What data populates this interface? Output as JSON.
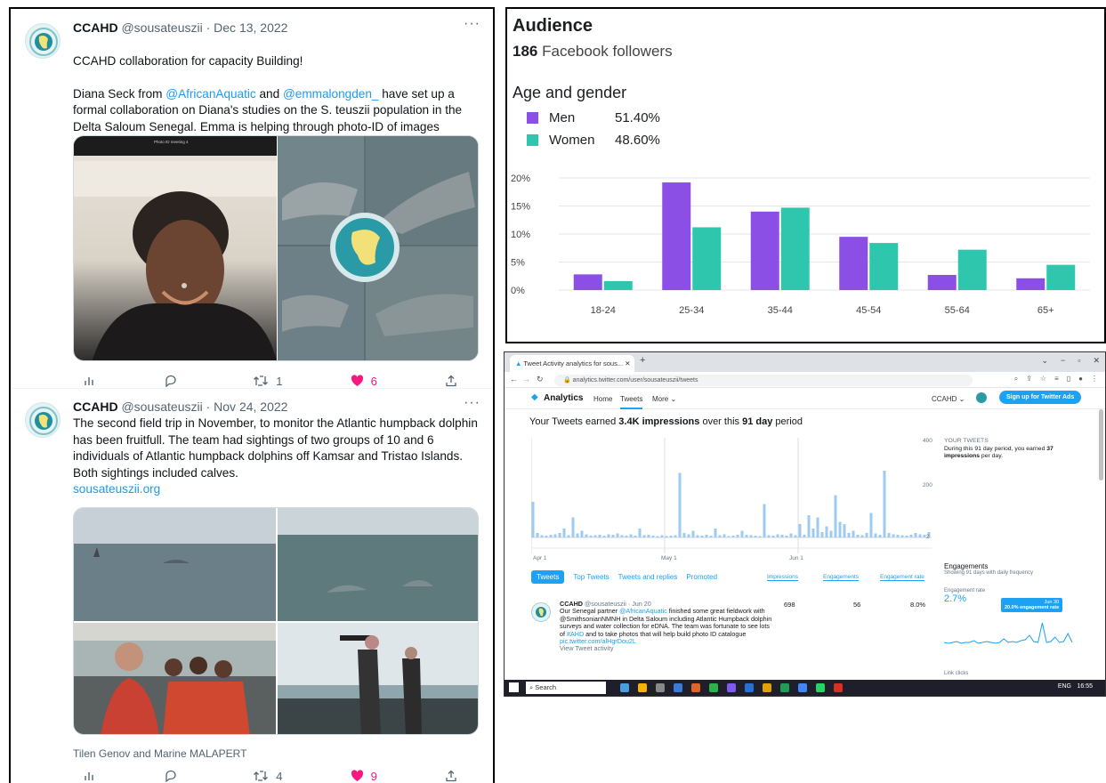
{
  "tweets": [
    {
      "name": "CCAHD",
      "handle": "@sousateuszii",
      "date": "· Dec 13, 2022",
      "more": "···",
      "lines": [
        "CCAHD collaboration for capacity Building!"
      ],
      "p2_a": "Diana Seck from ",
      "mention1": "@AfricanAquatic",
      "p2_b": " and ",
      "mention2": "@emmalongden_",
      "p2_c": " have set up a formal collaboration on Diana's studies on the S. teuszii population in the Delta Saloum Senegal.  Emma is helping through photo-ID of images collected during surveys.",
      "meeting_label": "Photo ID meeting 4",
      "actions": {
        "reply": "",
        "retweet": "1",
        "like": "6"
      }
    },
    {
      "name": "CCAHD",
      "handle": "@sousateuszii",
      "date": "· Nov 24, 2022",
      "more": "···",
      "text": "The second field trip in November, to monitor the Atlantic humpback dolphin has been fruitfull. The team had sightings of two groups of 10 and 6 individuals of Atlantic humpback dolphins off Kamsar and Tristao Islands. Both sightings included calves.",
      "link": "sousateuszii.org",
      "caption": "Tilen Genov and Marine MALAPERT",
      "actions": {
        "reply": "",
        "retweet": "4",
        "like": "9"
      }
    }
  ],
  "icons": {
    "views": "bar-chart-icon",
    "reply": "speech-bubble-icon",
    "retweet": "retweet-icon",
    "like": "heart-icon",
    "share": "share-icon"
  },
  "colors": {
    "men": "#8c4fe6",
    "women": "#2ec7ad",
    "twitter_blue": "#1d9bf0",
    "like_pink": "#f91880"
  },
  "audience": {
    "title": "Audience",
    "followers_count": "186",
    "followers_label": "Facebook followers",
    "age_gender_title": "Age and gender",
    "legend": [
      {
        "name": "Men",
        "value": "51.40%"
      },
      {
        "name": "Women",
        "value": "48.60%"
      }
    ]
  },
  "chart_data": {
    "type": "bar",
    "title": "Age and gender",
    "categories": [
      "18-24",
      "25-34",
      "35-44",
      "45-54",
      "55-64",
      "65+"
    ],
    "series": [
      {
        "name": "Men",
        "values": [
          2.8,
          19.2,
          14.0,
          9.5,
          2.7,
          2.1
        ]
      },
      {
        "name": "Women",
        "values": [
          1.6,
          11.2,
          14.7,
          8.4,
          7.2,
          4.5
        ]
      }
    ],
    "yticks": [
      "0%",
      "5%",
      "10%",
      "15%",
      "20%"
    ],
    "ylim": [
      0,
      20
    ],
    "grid": true,
    "legend": "top-left"
  },
  "analytics": {
    "tab_title": "Tweet Activity analytics for sous...",
    "url": "analytics.twitter.com/user/sousateuszii/tweets",
    "nav": {
      "brand": "Analytics",
      "home": "Home",
      "tweets": "Tweets",
      "more": "More",
      "account": "CCAHD",
      "signup": "Sign up for Twitter Ads"
    },
    "headline_pre": "Your Tweets earned ",
    "headline_imp": "3.4K impressions",
    "headline_mid": " over this ",
    "headline_days": "91 day",
    "headline_post": " period",
    "your_tweets": "YOUR TWEETS",
    "your_tweets_desc_a": "During this 91 day period, you earned ",
    "your_tweets_desc_b": "37",
    "your_tweets_desc_c": " impressions",
    "your_tweets_desc_d": " per day.",
    "axis_labels": [
      "Apr 1",
      "May 1",
      "Jun 1"
    ],
    "y_labels": [
      "400",
      "200",
      "2"
    ],
    "tabs": [
      "Tweets",
      "Top Tweets",
      "Tweets and replies",
      "Promoted"
    ],
    "columns": [
      "Impressions",
      "Engagements",
      "Engagement rate"
    ],
    "tweet": {
      "name": "CCAHD",
      "meta": "@sousateuszii · Jun 20",
      "text_a": "Our Senegal partner ",
      "mention": "@AfricanAquatic",
      "text_b": " finished some great fieldwork with @SmithsonianNMNH in Delta Saloum including Atlantic Humpback dolphin surveys and water collection for eDNA. The team was fortunate to see lots of ",
      "hashtag": "#AHD",
      "text_c": " and to take photos that will help build photo ID catalogue ",
      "pic": "pic.twitter.com/alHgrDou2L",
      "view": "View Tweet activity",
      "impressions": "698",
      "engagements": "56",
      "rate": "8.0%"
    },
    "engagements_title": "Engagements",
    "engagements_sub": "Showing 91 days with daily frequency",
    "eng_rate_label": "Engagement rate",
    "eng_rate": "2.7%",
    "tooltip_date": "Jun 30",
    "tooltip_text": "20.0% engagement rate",
    "link_clicks": "Link clicks",
    "taskbar": {
      "search": "Search",
      "lang": "ENG",
      "time": "16:55"
    }
  }
}
